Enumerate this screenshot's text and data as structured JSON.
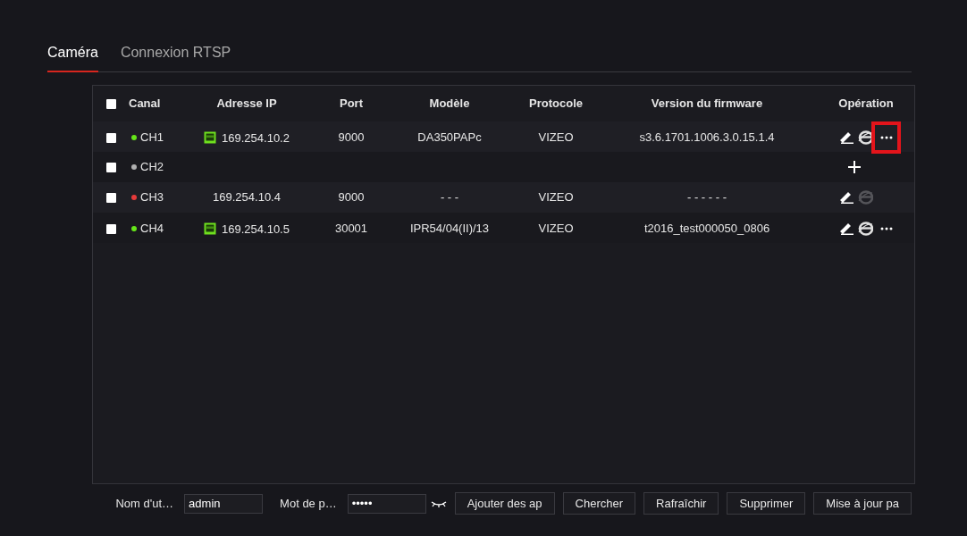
{
  "tabs": [
    {
      "label": "Caméra",
      "selected": true
    },
    {
      "label": "Connexion RTSP",
      "selected": false
    }
  ],
  "table": {
    "select_all_checked": false,
    "columns": [
      "Canal",
      "Adresse IP",
      "Port",
      "Modèle",
      "Protocole",
      "Version du firmware",
      "Opération"
    ],
    "rows": [
      {
        "checked": false,
        "channel": "CH1",
        "color": "#66e61a",
        "link_icon": true,
        "ip": "169.254.10.2",
        "port": "9000",
        "model": "DA350PAPc",
        "protocol": "VIZEO",
        "firmware": "s3.6.1701.1006.3.0.15.1.4",
        "operations": [
          {
            "kind": "edit"
          },
          {
            "kind": "browser",
            "disabled": false
          },
          {
            "kind": "more",
            "highlighted": true
          }
        ]
      },
      {
        "checked": false,
        "channel": "CH2",
        "color": "#b0b0b0",
        "link_icon": false,
        "operations": [
          {
            "kind": "add"
          }
        ]
      },
      {
        "checked": false,
        "channel": "CH3",
        "color": "#e63a3a",
        "link_icon": false,
        "ip": "169.254.10.4",
        "port": "9000",
        "model": "- - -",
        "protocol": "VIZEO",
        "firmware": "- - - - - -",
        "operations": [
          {
            "kind": "edit"
          },
          {
            "kind": "browser",
            "disabled": true
          }
        ]
      },
      {
        "checked": false,
        "channel": "CH4",
        "color": "#66e61a",
        "link_icon": true,
        "ip": "169.254.10.5",
        "port": "30001",
        "model": "IPR54/04(II)/13",
        "protocol": "VIZEO",
        "firmware": "t2016_test000050_0806",
        "operations": [
          {
            "kind": "edit"
          },
          {
            "kind": "browser",
            "disabled": false
          },
          {
            "kind": "more",
            "highlighted": false
          }
        ]
      }
    ]
  },
  "footer": {
    "username_label": "Nom d'ut…",
    "username": "admin",
    "password_label": "Mot de p…",
    "password": "•••••",
    "buttons": [
      "Ajouter des ap",
      "Chercher",
      "Rafraîchir",
      "Supprimer",
      "Mise à jour pa"
    ]
  }
}
